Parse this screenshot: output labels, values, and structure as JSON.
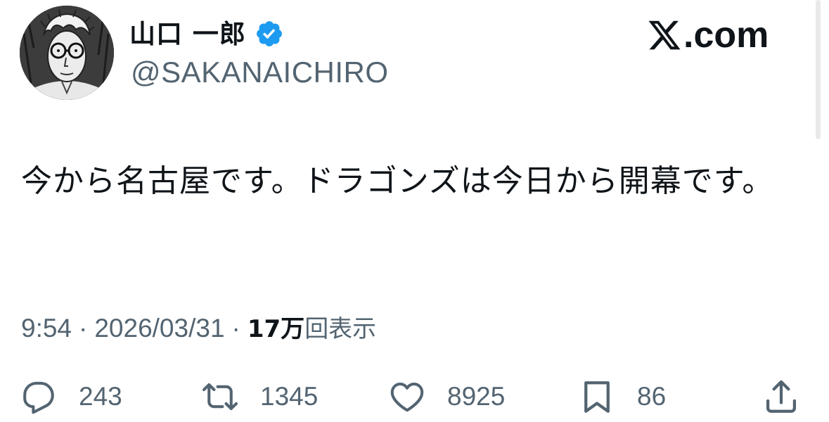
{
  "author": {
    "display_name": "山口 一郎",
    "handle": "@SAKANAICHIRO",
    "verified": true,
    "avatar_icon": "avatar-illustration"
  },
  "brand": {
    "text": ".com",
    "icon": "x-logo-icon"
  },
  "tweet": {
    "text": "今から名古屋です。ドラゴンズは今日から開幕です。"
  },
  "meta": {
    "time": "9:54",
    "separator": "·",
    "date": "2026/03/31",
    "views_count": "17万",
    "views_label": "回表示"
  },
  "actions": {
    "replies": "243",
    "retweets": "1345",
    "likes": "8925",
    "bookmarks": "86"
  },
  "colors": {
    "verified_badge": "#1d9bf0",
    "text_primary": "#0f1419",
    "text_secondary": "#536471"
  }
}
